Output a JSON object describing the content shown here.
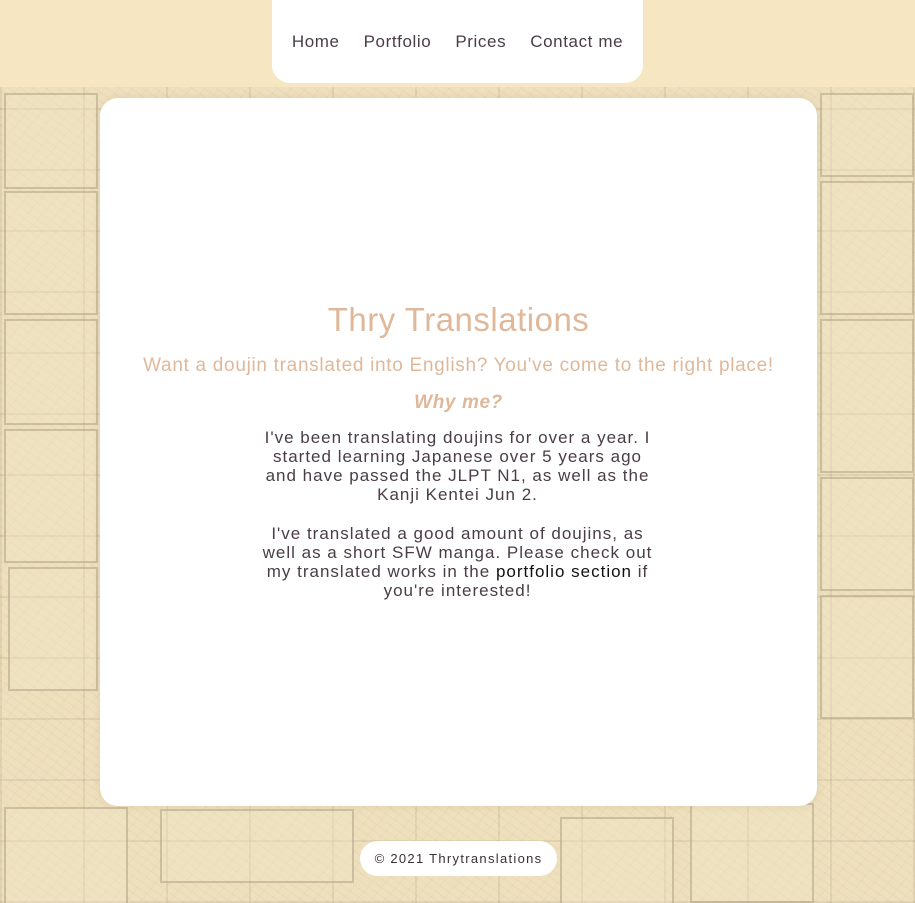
{
  "nav": {
    "items": [
      "Home",
      "Portfolio",
      "Prices",
      "Contact me"
    ]
  },
  "main": {
    "title": "Thry Translations",
    "subtitle": "Want a doujin translated into English? You've come to the right place!",
    "why_heading": "Why me?",
    "paragraph1": "I've been translating doujins for over a year. I started learning Japanese over 5 years ago and have passed the JLPT N1, as well as the Kanji Kentei Jun 2.",
    "paragraph2_before": "I've translated a good amount of doujins, as well as a short SFW manga. Please check out my translated works in the",
    "paragraph2_link": "portfolio section",
    "paragraph2_after": "if you're interested!"
  },
  "footer": {
    "text": "© 2021 Thrytranslations"
  },
  "colors": {
    "background": "#f6e6c1",
    "accent": "#dfb89a",
    "text": "#4a3d47",
    "card": "#ffffff"
  }
}
